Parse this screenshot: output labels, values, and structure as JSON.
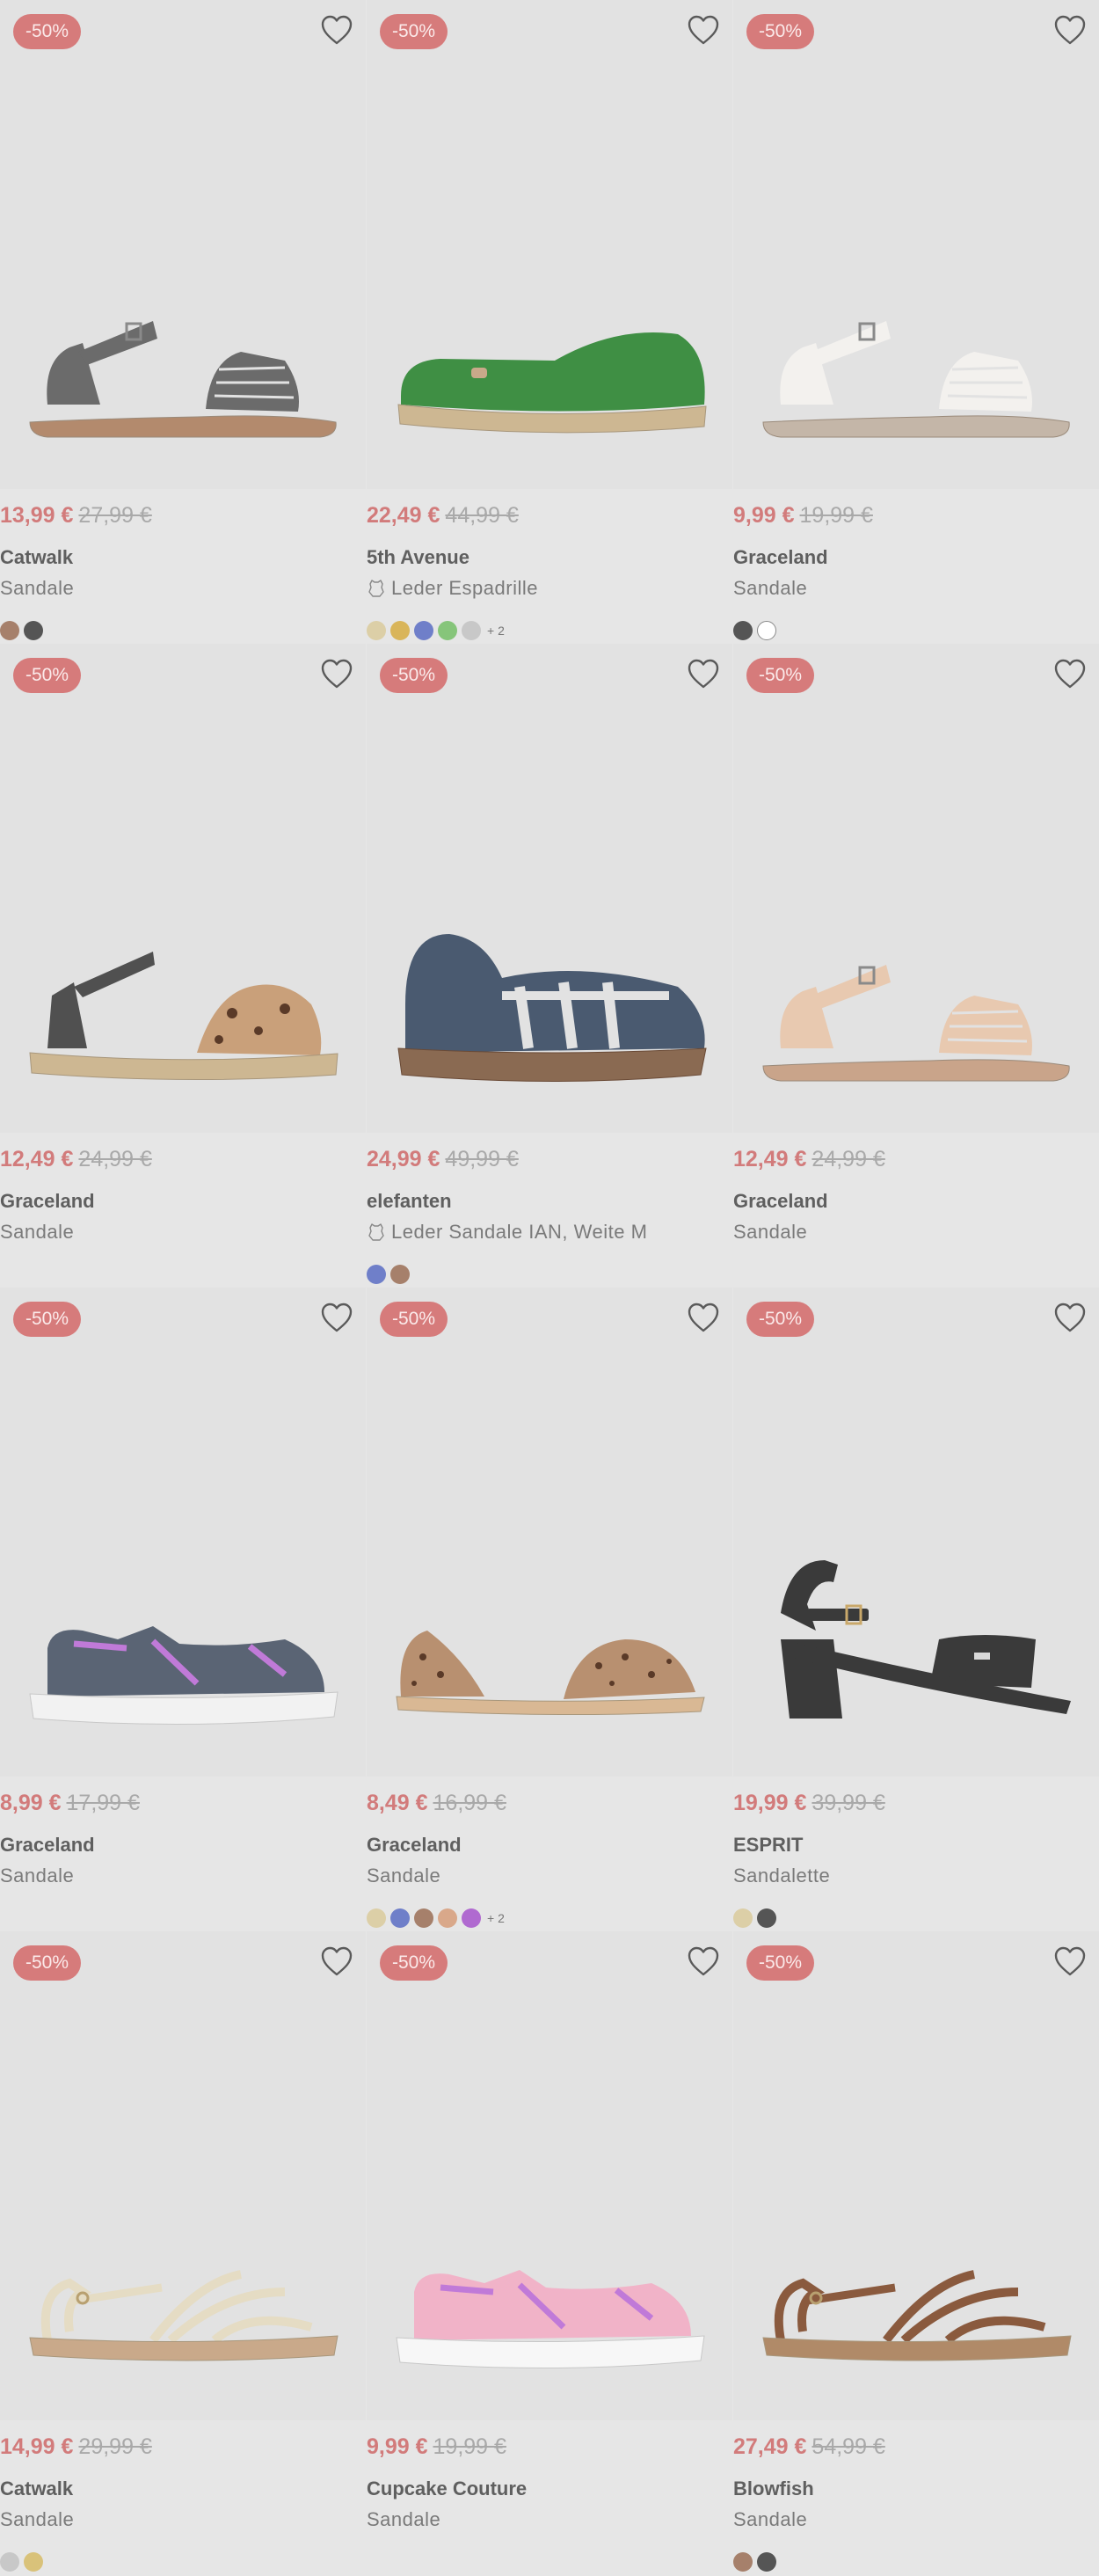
{
  "currency": "€",
  "wishlist_icon": "heart-outline-icon",
  "leather_icon": "leather-hide-icon",
  "colors": {
    "sale": "#d67b7b",
    "price": "#d27b7b",
    "background": "#e6e6e6"
  },
  "products": [
    {
      "badge": "-50%",
      "price": "13,99 €",
      "old_price": "27,99 €",
      "brand": "Catwalk",
      "type": "Sandale",
      "leather": false,
      "swatches": [
        "#a6806b",
        "#555555"
      ],
      "more": "",
      "shoe": "sandal",
      "colors": [
        "#6b6b6b",
        "#b38a6d"
      ]
    },
    {
      "badge": "-50%",
      "price": "22,49 €",
      "old_price": "44,99 €",
      "brand": "5th Avenue",
      "type": "Leder Espadrille",
      "leather": true,
      "swatches": [
        "#dccfa7",
        "#d9b55a",
        "#6f7fc9",
        "#86c57a",
        "#c8c8c8"
      ],
      "more": "+ 2",
      "shoe": "espadrille",
      "colors": [
        "#3f8f44",
        "#cdb792"
      ]
    },
    {
      "badge": "-50%",
      "price": "9,99 €",
      "old_price": "19,99 €",
      "brand": "Graceland",
      "type": "Sandale",
      "leather": false,
      "swatches": [
        "#555555",
        "#ffffff"
      ],
      "more": "",
      "shoe": "sandal",
      "colors": [
        "#f3f1ee",
        "#c4b6a8"
      ]
    },
    {
      "badge": "-50%",
      "price": "12,49 €",
      "old_price": "24,99 €",
      "brand": "Graceland",
      "type": "Sandale",
      "leather": false,
      "swatches": [],
      "more": "",
      "shoe": "espadrille-sandal",
      "colors": [
        "#505050",
        "#cdb792"
      ]
    },
    {
      "badge": "-50%",
      "price": "24,99 €",
      "old_price": "49,99 €",
      "brand": "elefanten",
      "type": "Leder Sandale IAN, Weite M",
      "leather": true,
      "swatches": [
        "#6f7fc9",
        "#a6806b"
      ],
      "more": "",
      "shoe": "closed-sandal",
      "colors": [
        "#4a5a70",
        "#8a6a52"
      ]
    },
    {
      "badge": "-50%",
      "price": "12,49 €",
      "old_price": "24,99 €",
      "brand": "Graceland",
      "type": "Sandale",
      "leather": false,
      "swatches": [],
      "more": "",
      "shoe": "sandal",
      "colors": [
        "#e8c9b0",
        "#c9a48a"
      ]
    },
    {
      "badge": "-50%",
      "price": "8,99 €",
      "old_price": "17,99 €",
      "brand": "Graceland",
      "type": "Sandale",
      "leather": false,
      "swatches": [],
      "more": "",
      "shoe": "sport-sandal",
      "colors": [
        "#5a6474",
        "#f2f2f2"
      ]
    },
    {
      "badge": "-50%",
      "price": "8,49 €",
      "old_price": "16,99 €",
      "brand": "Graceland",
      "type": "Sandale",
      "leather": false,
      "swatches": [
        "#dccfa7",
        "#6f7fc9",
        "#a6806b",
        "#d9a88a",
        "#b06ad0"
      ],
      "more": "+ 2",
      "shoe": "leo-flat",
      "colors": [
        "#b89070",
        "#d9b894"
      ]
    },
    {
      "badge": "-50%",
      "price": "19,99 €",
      "old_price": "39,99 €",
      "brand": "ESPRIT",
      "type": "Sandalette",
      "leather": false,
      "swatches": [
        "#dccfa7",
        "#555555"
      ],
      "more": "",
      "shoe": "heel",
      "colors": [
        "#3a3a3a",
        "#3a3a3a"
      ]
    },
    {
      "badge": "-50%",
      "price": "14,99 €",
      "old_price": "29,99 €",
      "brand": "Catwalk",
      "type": "Sandale",
      "leather": false,
      "swatches": [
        "#c8c8c8",
        "#d9c27a"
      ],
      "more": "",
      "shoe": "strappy",
      "colors": [
        "#e5dcc4",
        "#c9a98a"
      ]
    },
    {
      "badge": "-50%",
      "price": "9,99 €",
      "old_price": "19,99 €",
      "brand": "Cupcake Couture",
      "type": "Sandale",
      "leather": false,
      "swatches": [],
      "more": "",
      "shoe": "sport-sandal",
      "colors": [
        "#f1b3c8",
        "#f7f7f7"
      ]
    },
    {
      "badge": "-50%",
      "price": "27,49 €",
      "old_price": "54,99 €",
      "brand": "Blowfish",
      "type": "Sandale",
      "leather": false,
      "swatches": [
        "#a6806b",
        "#555555"
      ],
      "more": "",
      "shoe": "strappy",
      "colors": [
        "#8a5a3e",
        "#b08a68"
      ]
    }
  ]
}
